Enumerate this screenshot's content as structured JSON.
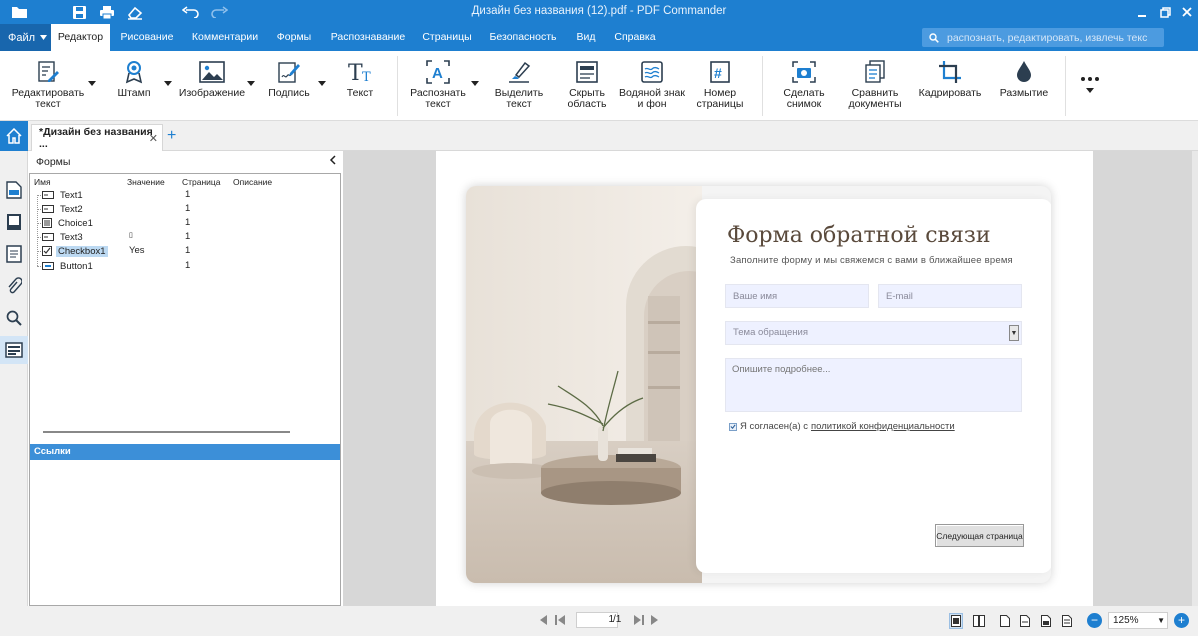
{
  "window": {
    "title": "Дизайн без названия (12).pdf - PDF Commander",
    "accent_color": "#1e7fd0"
  },
  "menu": {
    "file_label": "Файл",
    "tabs": [
      "Редактор",
      "Рисование",
      "Комментарии",
      "Формы",
      "Распознавание",
      "Страницы",
      "Безопасность",
      "Вид",
      "Справка"
    ],
    "active_tab": "Редактор",
    "search_placeholder": "распознать, редактировать, извлечь текст"
  },
  "ribbon": {
    "buttons": [
      {
        "label": "Редактировать текст",
        "icon": "edit-text-icon"
      },
      {
        "label": "Штамп",
        "icon": "stamp-icon"
      },
      {
        "label": "Изображение",
        "icon": "image-icon"
      },
      {
        "label": "Подпись",
        "icon": "signature-icon"
      },
      {
        "label": "Текст",
        "icon": "text-icon"
      },
      {
        "label": "Распознать текст",
        "icon": "ocr-icon"
      },
      {
        "label": "Выделить текст",
        "icon": "highlight-icon"
      },
      {
        "label": "Скрыть область",
        "icon": "redact-icon"
      },
      {
        "label": "Водяной знак и фон",
        "icon": "watermark-icon"
      },
      {
        "label": "Номер страницы",
        "icon": "page-number-icon"
      },
      {
        "label": "Сделать снимок",
        "icon": "snapshot-icon"
      },
      {
        "label": "Сравнить документы",
        "icon": "compare-icon"
      },
      {
        "label": "Кадрировать",
        "icon": "crop-icon"
      },
      {
        "label": "Размытие",
        "icon": "blur-icon"
      }
    ],
    "more_icon": "more-icon"
  },
  "tabs": {
    "doc_tab_label": "*Дизайн без названия ...",
    "close_symbol": "✕",
    "add_symbol": "+"
  },
  "forms_panel": {
    "title": "Формы",
    "columns": [
      "Имя",
      "Значение",
      "Страница",
      "Описание"
    ],
    "rows": [
      {
        "name": "Text1",
        "value": "",
        "page": "1",
        "type": "text-field"
      },
      {
        "name": "Text2",
        "value": "",
        "page": "1",
        "type": "text-field"
      },
      {
        "name": "Choice1",
        "value": "",
        "page": "1",
        "type": "choice-field"
      },
      {
        "name": "Text3",
        "value": "▯",
        "page": "1",
        "type": "text-field"
      },
      {
        "name": "Checkbox1",
        "value": "Yes",
        "page": "1",
        "type": "checkbox-field",
        "selected": true
      },
      {
        "name": "Button1",
        "value": "",
        "page": "1",
        "type": "button-field"
      }
    ],
    "links_header": "Ссылки"
  },
  "document": {
    "form_title": "Форма обратной связи",
    "form_subtitle": "Заполните форму и мы свяжемся с вами в ближайшее время",
    "name_placeholder": "Ваше имя",
    "email_placeholder": "E-mail",
    "topic_placeholder": "Тема обращения",
    "details_placeholder": "Опишите подробнее...",
    "consent_text": "Я согласен(а) с",
    "consent_link": "политикой конфиденциальности",
    "next_button": "Следующая страница",
    "consent_checked": true
  },
  "statusbar": {
    "current_page": "1",
    "total_pages": "/1",
    "zoom": "125%",
    "zoom_minus": "−",
    "zoom_plus": "+"
  }
}
